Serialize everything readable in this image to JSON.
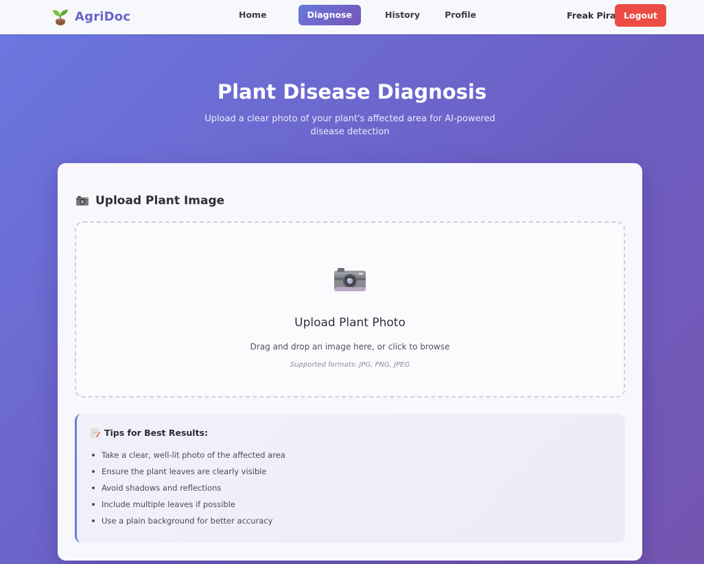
{
  "nav": {
    "brand": "AgriDoc",
    "links": [
      {
        "label": "Home",
        "active": false
      },
      {
        "label": "Diagnose",
        "active": true
      },
      {
        "label": "History",
        "active": false
      },
      {
        "label": "Profile",
        "active": false
      }
    ],
    "user_name": "Freak Pirate",
    "logout_label": "Logout"
  },
  "hero": {
    "title": "Plant Disease Diagnosis",
    "subtitle": "Upload a clear photo of your plant's affected area for AI-powered disease detection"
  },
  "upload_card": {
    "icon": "camera-icon",
    "title": "Upload Plant Image",
    "dropzone": {
      "icon": "camera-icon",
      "title": "Upload Plant Photo",
      "instruction": "Drag and drop an image here, or click to browse",
      "formats": "Supported formats: JPG, PNG, JPEG"
    }
  },
  "tips": {
    "icon": "memo-icon",
    "title": "Tips for Best Results:",
    "items": [
      "Take a clear, well-lit photo of the affected area",
      "Ensure the plant leaves are clearly visible",
      "Avoid shadows and reflections",
      "Include multiple leaves if possible",
      "Use a plain background for better accuracy"
    ]
  },
  "colors": {
    "brand": "#6b63c8",
    "accent_gradient_start": "#6a77dc",
    "accent_gradient_end": "#7556b6",
    "logout": "#ec4c44"
  }
}
